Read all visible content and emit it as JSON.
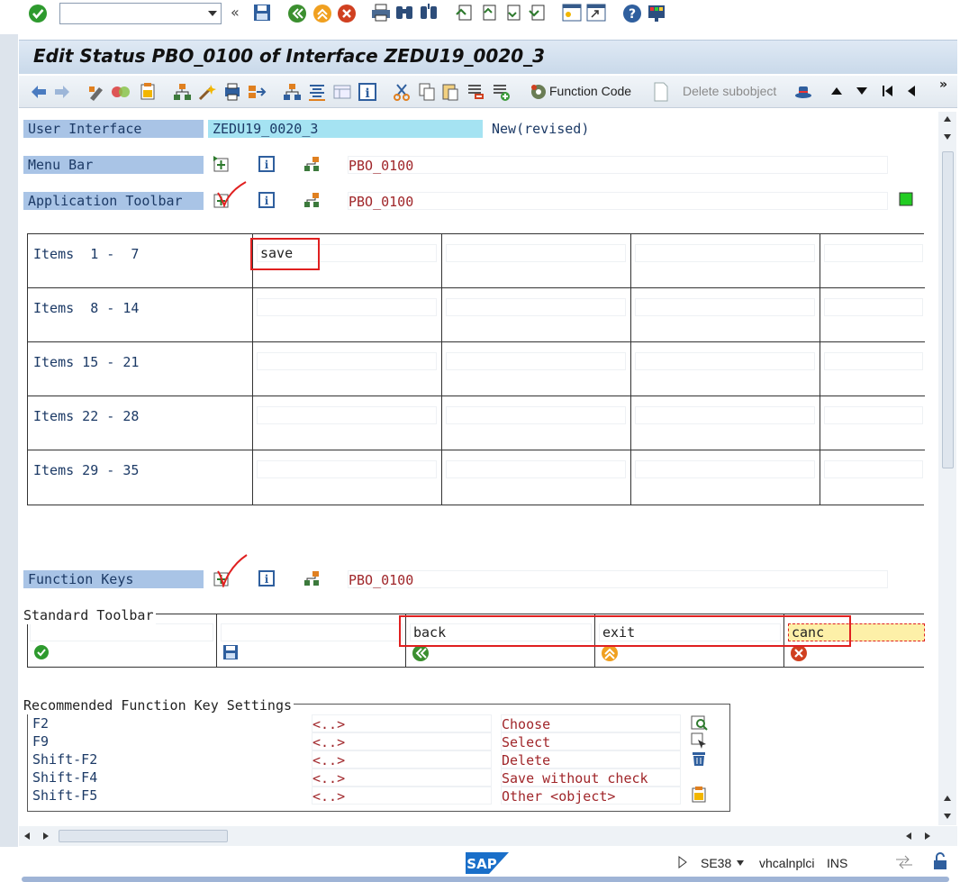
{
  "command_field": {
    "value": ""
  },
  "window_title": "Edit Status PBO_0100 of Interface ZEDU19_0020_3",
  "toolbar": {
    "function_code_label": "Function Code",
    "delete_subobject_label": "Delete subobject"
  },
  "user_interface": {
    "label": "User Interface",
    "value": "ZEDU19_0020_3",
    "status": "New(revised)"
  },
  "menu_bar": {
    "label": "Menu Bar",
    "value": "PBO_0100"
  },
  "application_toolbar": {
    "label": "Application Toolbar",
    "value": "PBO_0100",
    "rows": [
      {
        "label": "Items  1 -  7",
        "cells": [
          "save",
          "",
          "",
          ""
        ]
      },
      {
        "label": "Items  8 - 14",
        "cells": [
          "",
          "",
          "",
          ""
        ]
      },
      {
        "label": "Items 15 - 21",
        "cells": [
          "",
          "",
          "",
          ""
        ]
      },
      {
        "label": "Items 22 - 28",
        "cells": [
          "",
          "",
          "",
          ""
        ]
      },
      {
        "label": "Items 29 - 35",
        "cells": [
          "",
          "",
          "",
          ""
        ]
      }
    ]
  },
  "function_keys": {
    "label": "Function Keys",
    "value": "PBO_0100"
  },
  "standard_toolbar": {
    "title": "Standard Toolbar",
    "cells": [
      {
        "value": "",
        "icon": "check-icon"
      },
      {
        "value": "",
        "icon": "save-icon"
      },
      {
        "value": "back",
        "icon": "back-icon"
      },
      {
        "value": "exit",
        "icon": "exit-icon"
      },
      {
        "value": "canc",
        "icon": "cancel-icon"
      }
    ]
  },
  "recommended": {
    "title": "Recommended Function Key Settings",
    "rows": [
      {
        "key": "F2",
        "code": "<..>",
        "text": "Choose",
        "icon": "choose-icon"
      },
      {
        "key": "F9",
        "code": "<..>",
        "text": "Select",
        "icon": "select-icon"
      },
      {
        "key": "Shift-F2",
        "code": "<..>",
        "text": "Delete",
        "icon": "trash-icon"
      },
      {
        "key": "Shift-F4",
        "code": "<..>",
        "text": "Save without check",
        "icon": ""
      },
      {
        "key": "Shift-F5",
        "code": "<..>",
        "text": "Other <object>",
        "icon": "other-object-icon"
      }
    ]
  },
  "status_bar": {
    "logo": "SAP",
    "transaction": "SE38",
    "server": "vhcalnplci",
    "mode": "INS"
  },
  "colors": {
    "label_bg": "#a9c4e6",
    "value_red": "#a0262a",
    "highlight": "#e02020",
    "active_field": "#fdf0a8"
  }
}
